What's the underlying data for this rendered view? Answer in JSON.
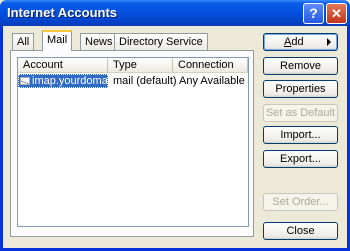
{
  "window": {
    "title": "Internet Accounts",
    "help_button": "?",
    "close_button": "✕"
  },
  "tabs": [
    {
      "label": "All",
      "active": false
    },
    {
      "label": "Mail",
      "active": true
    },
    {
      "label": "News",
      "active": false
    },
    {
      "label": "Directory Service",
      "active": false
    }
  ],
  "list": {
    "columns": [
      "Account",
      "Type",
      "Connection"
    ],
    "rows": [
      {
        "account": "imap.yourdomain....",
        "type": "mail (default)",
        "connection": "Any Available",
        "selected": true
      }
    ]
  },
  "buttons": {
    "add": {
      "label": "Add",
      "underline": "A",
      "rest": "dd",
      "enabled": true
    },
    "remove": {
      "label": "Remove",
      "enabled": true
    },
    "properties": {
      "label": "Properties",
      "enabled": true
    },
    "set_default": {
      "label": "Set as Default",
      "enabled": false
    },
    "import": {
      "label": "Import...",
      "enabled": true
    },
    "export": {
      "label": "Export...",
      "enabled": true
    },
    "set_order": {
      "label": "Set Order...",
      "enabled": false
    },
    "close": {
      "label": "Close",
      "enabled": true
    }
  },
  "colors": {
    "titlebar": "#0553e3",
    "dialog_bg": "#ece9d8",
    "selection": "#316ac5",
    "active_tab_accent": "#ffc83c"
  }
}
